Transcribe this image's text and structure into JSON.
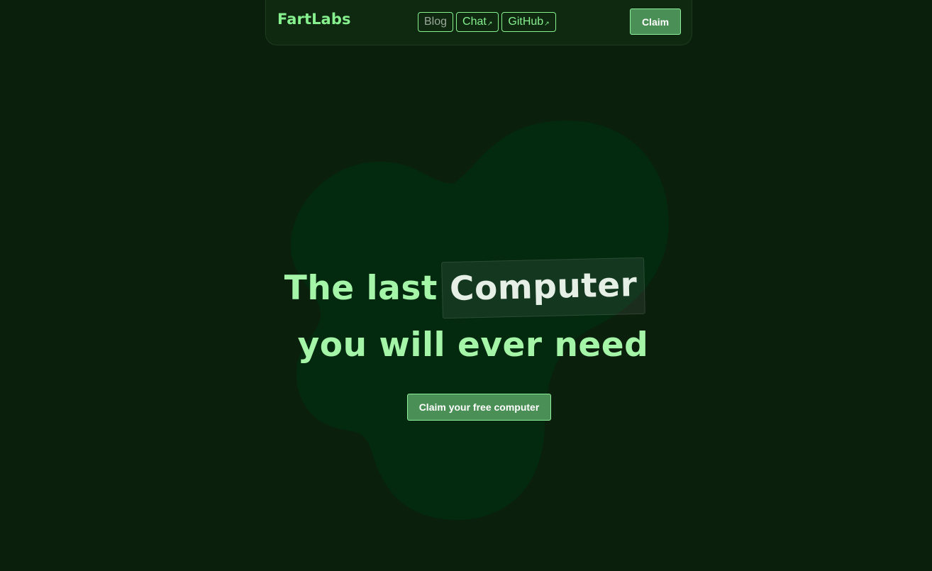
{
  "header": {
    "brand": "FartLabs",
    "nav": [
      {
        "label": "Blog",
        "external": false
      },
      {
        "label": "Chat",
        "external": true
      },
      {
        "label": "GitHub",
        "external": true
      }
    ],
    "external_glyph": "↗",
    "claim_label": "Claim"
  },
  "hero": {
    "title_prefix": "The last",
    "title_highlight": "Computer",
    "title_line2": "you will ever need",
    "cta_label": "Claim your free computer"
  },
  "colors": {
    "background": "#0a1f0c",
    "navbar": "#0f2910",
    "accent": "#86f08e",
    "button": "#4a8f55",
    "blob": "#03290f"
  }
}
